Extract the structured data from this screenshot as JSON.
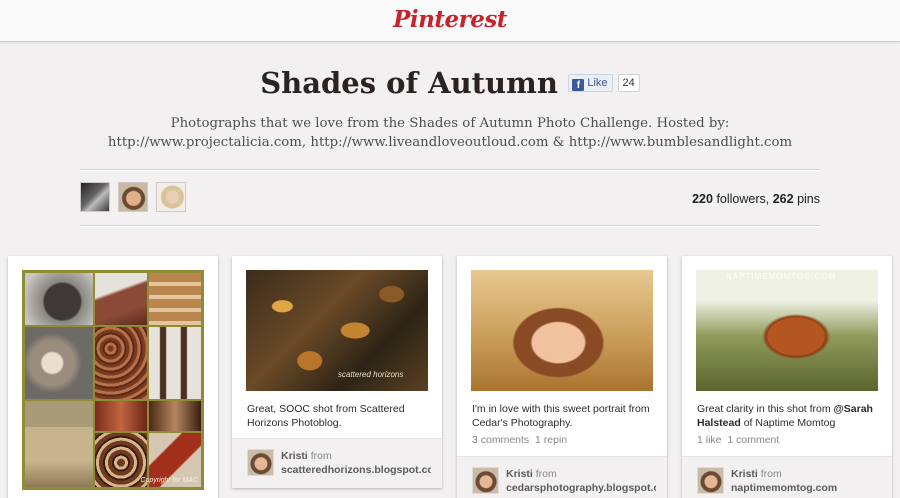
{
  "header": {
    "logo": "Pinterest"
  },
  "board": {
    "title": "Shades of Autumn",
    "like_label": "Like",
    "like_count": "24",
    "description": "Photographs that we love from the Shades of Autumn Photo Challenge. Hosted by: http://www.projectalicia.com, http://www.liveandloveoutloud.com & http://www.bumblesandlight.com",
    "followers_count": "220",
    "followers_label": "followers,",
    "pins_count": "262",
    "pins_label": "pins"
  },
  "pins": [
    {
      "image_icon": "autumn-collage-image",
      "watermark": "Copyright for MAC"
    },
    {
      "image_icon": "autumn-leaves-image",
      "watermark": "scattered horizons",
      "description": "Great, SOOC shot from Scattered Horizons Photoblog.",
      "user": "Kristi",
      "from_label": "from",
      "source": "scatteredhorizons.blogspot.com"
    },
    {
      "image_icon": "smiling-girl-image",
      "description": "I'm in love with this sweet portrait from Cedar's Photography.",
      "comments": "3 comments",
      "repins": "1 repin",
      "user": "Kristi",
      "from_label": "from",
      "source": "cedarsphotography.blogspot.com"
    },
    {
      "image_icon": "dried-leaf-image",
      "watermark": "NAPTIMEMOMTOG.COM",
      "description_pre": "Great clarity in this shot from ",
      "description_mention": "@Sarah Halstead",
      "description_post": " of Naptime Momtog",
      "likes": "1 like",
      "comments": "1 comment",
      "user": "Kristi",
      "from_label": "from",
      "source": "naptimemomtog.com"
    }
  ],
  "colors": {
    "brand": "#c8232c",
    "facebook": "#3b5998",
    "background": "#f2f0f0"
  }
}
